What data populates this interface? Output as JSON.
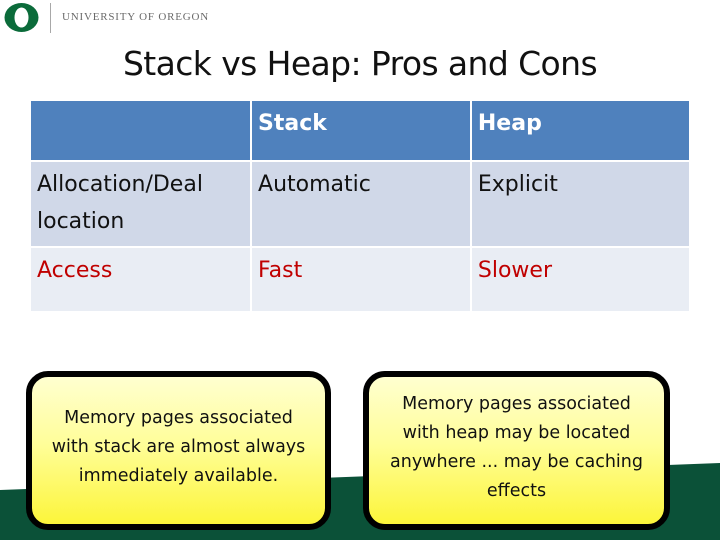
{
  "header": {
    "logo_icon": "oregon-o-logo",
    "university_name": "UNIVERSITY OF OREGON"
  },
  "slide": {
    "title": "Stack vs Heap: Pros and Cons"
  },
  "table": {
    "columns": [
      "",
      "Stack",
      "Heap"
    ],
    "rows": [
      {
        "label": "Allocation/Deallocation",
        "label_display": "Allocation/Deal location",
        "stack": "Automatic",
        "heap": "Explicit"
      },
      {
        "label": "Access",
        "stack": "Fast",
        "heap": "Slower"
      }
    ]
  },
  "callouts": {
    "stack": "Memory pages associated with stack are almost always immediately available.",
    "heap": "Memory pages associated with heap may be located anywhere ... may be caching effects"
  },
  "colors": {
    "brand_green": "#0b5138",
    "header_blue": "#4f81bd",
    "row_light": "#d0d8e8",
    "row_lighter": "#e9edf4",
    "accent_red": "#c00000",
    "callout_yellow": "#fcf53a"
  }
}
